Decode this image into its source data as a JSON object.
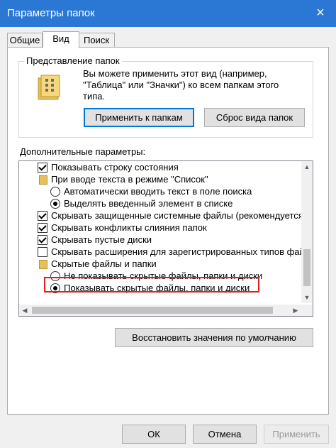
{
  "window": {
    "title": "Параметры папок",
    "close_icon": "×"
  },
  "tabs": [
    {
      "label": "Общие",
      "active": false
    },
    {
      "label": "Вид",
      "active": true
    },
    {
      "label": "Поиск",
      "active": false
    }
  ],
  "folder_views": {
    "legend": "Представление папок",
    "description": "Вы можете применить этот вид (например, \"Таблица\" или \"Значки\") ко всем папкам этого типа.",
    "apply_button": "Применить к папкам",
    "reset_button": "Сброс вида папок"
  },
  "advanced": {
    "legend": "Дополнительные параметры:",
    "items": [
      {
        "kind": "checkbox",
        "checked": true,
        "label": "Показывать строку состояния"
      },
      {
        "kind": "folder",
        "label": "При вводе текста в режиме \"Список\""
      },
      {
        "kind": "radio",
        "checked": false,
        "label": "Автоматически вводить текст в поле поиска"
      },
      {
        "kind": "radio",
        "checked": true,
        "label": "Выделять введенный элемент в списке"
      },
      {
        "kind": "checkbox",
        "checked": true,
        "label": "Скрывать защищенные системные файлы (рекомендуется)"
      },
      {
        "kind": "checkbox",
        "checked": true,
        "label": "Скрывать конфликты слияния папок"
      },
      {
        "kind": "checkbox",
        "checked": true,
        "label": "Скрывать пустые диски"
      },
      {
        "kind": "checkbox",
        "checked": false,
        "label": "Скрывать расширения для зарегистрированных типов файлов"
      },
      {
        "kind": "folder",
        "label": "Скрытые файлы и папки"
      },
      {
        "kind": "radio",
        "checked": false,
        "label": "Не показывать скрытые файлы, папки и диски"
      },
      {
        "kind": "radio",
        "checked": true,
        "label": "Показывать скрытые файлы, папки и диски"
      }
    ],
    "restore_button": "Восстановить значения по умолчанию"
  },
  "footer": {
    "ok": "ОК",
    "cancel": "Отмена",
    "apply": "Применить"
  },
  "colors": {
    "titlebar": "#2b78d4",
    "highlight": "#e02020"
  }
}
